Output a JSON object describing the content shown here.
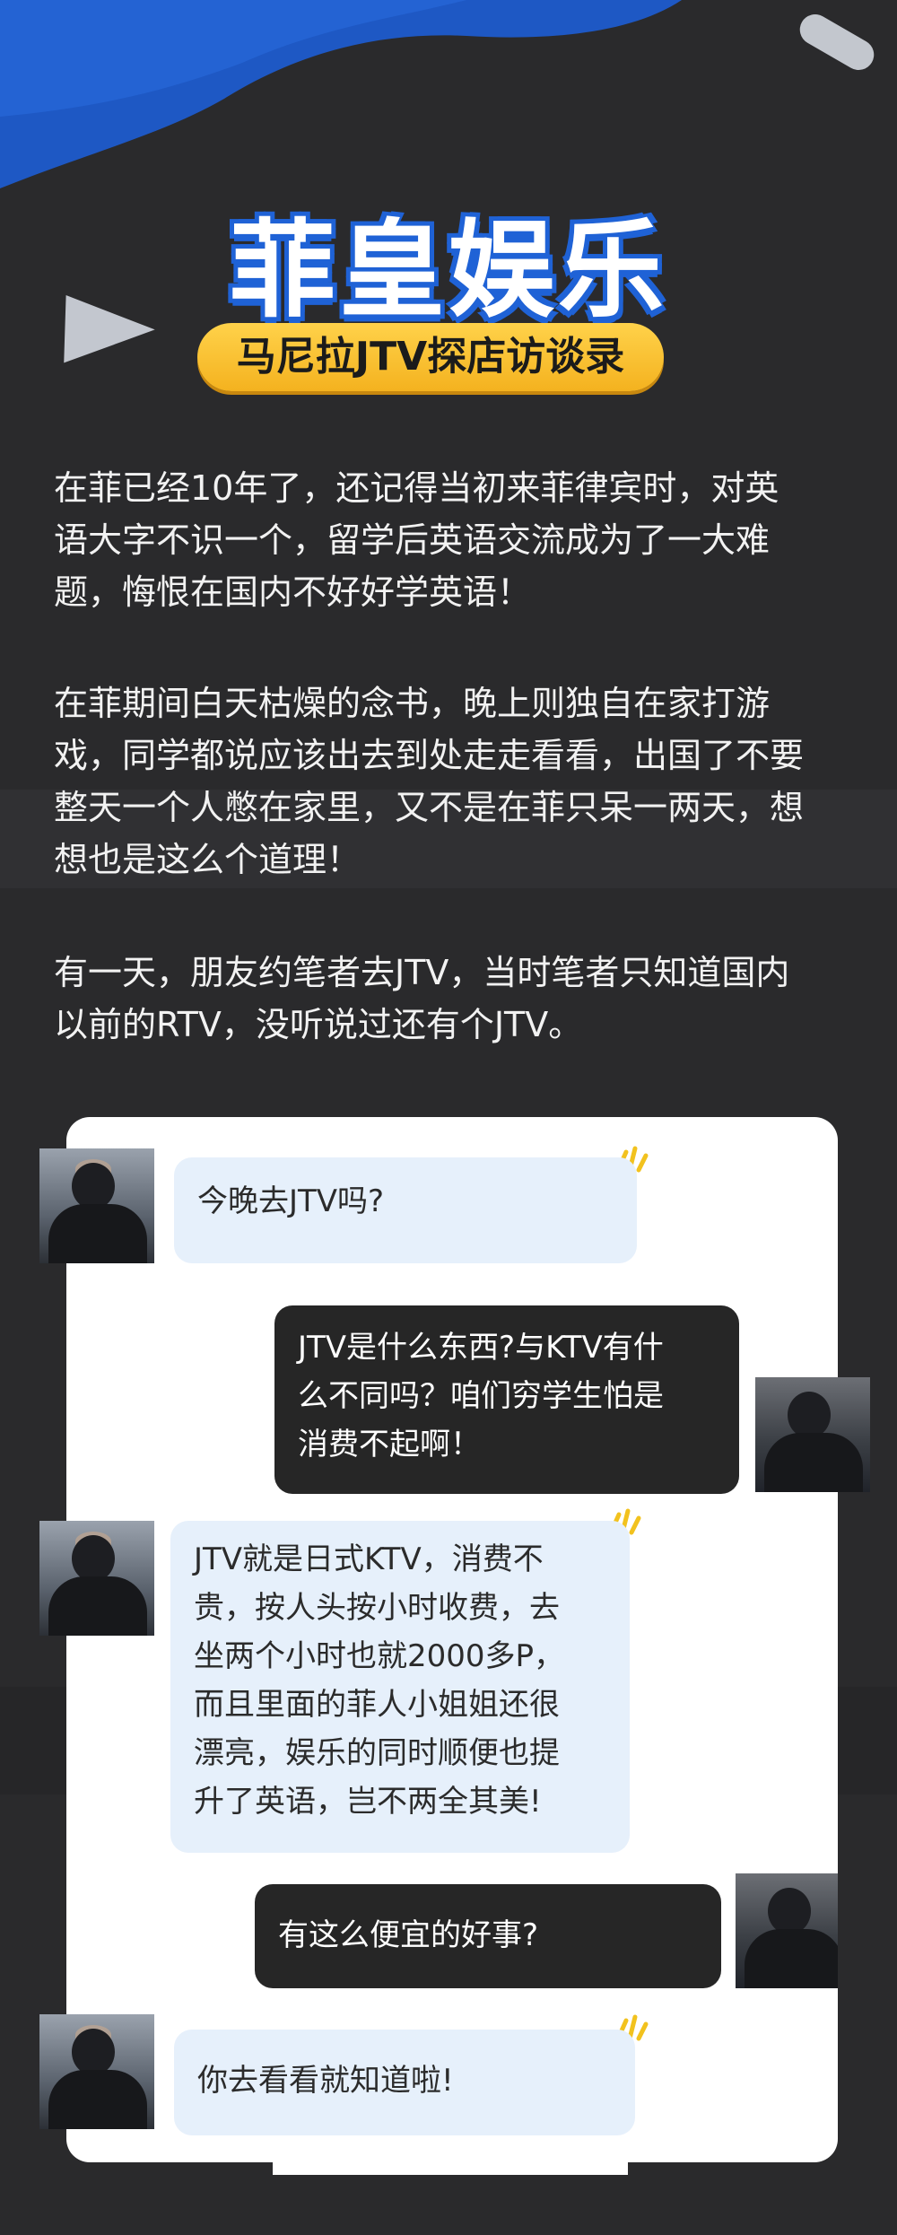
{
  "header": {
    "title": "菲皇娱乐",
    "subtitle": "马尼拉JTV探店访谈录"
  },
  "paragraphs": [
    [
      "在菲已经10年了，还记得当初来菲律宾时，对英",
      "语大字不识一个，留学后英语交流成为了一大难",
      "题，悔恨在国内不好好学英语！"
    ],
    [
      "在菲期间白天枯燥的念书，晚上则独自在家打游",
      "戏，同学都说应该出去到处走走看看，出国了不要",
      "整天一个人憋在家里，又不是在菲只呆一两天，想",
      "想也是这么个道理！"
    ],
    [
      "有一天，朋友约笔者去JTV，当时笔者只知道国内",
      "以前的RTV，没听说过还有个JTV。"
    ]
  ],
  "chat": [
    {
      "side": "left",
      "lines": [
        "今晚去JTV吗?"
      ]
    },
    {
      "side": "right",
      "lines": [
        "JTV是什么东西?与KTV有什",
        "么不同吗？咱们穷学生怕是",
        "消费不起啊！"
      ]
    },
    {
      "side": "left",
      "lines": [
        "JTV就是日式KTV，消费不",
        "贵，按人头按小时收费，去",
        "坐两个小时也就2000多P，",
        "而且里面的菲人小姐姐还很",
        "漂亮，娱乐的同时顺便也提",
        "升了英语，岂不两全其美!"
      ]
    },
    {
      "side": "right",
      "lines": [
        "有这么便宜的好事?"
      ]
    },
    {
      "side": "left",
      "lines": [
        "你去看看就知道啦!"
      ]
    }
  ],
  "colors": {
    "background": "#2a2a2c",
    "accent_blue": "#1f62d6",
    "pill_yellow": "#f4b21f",
    "bubble_left": "#e6f0fb",
    "bubble_right": "#262626",
    "spark_yellow": "#f2c21e"
  },
  "icons": [
    "avatar-photo",
    "sparkle-icon"
  ]
}
